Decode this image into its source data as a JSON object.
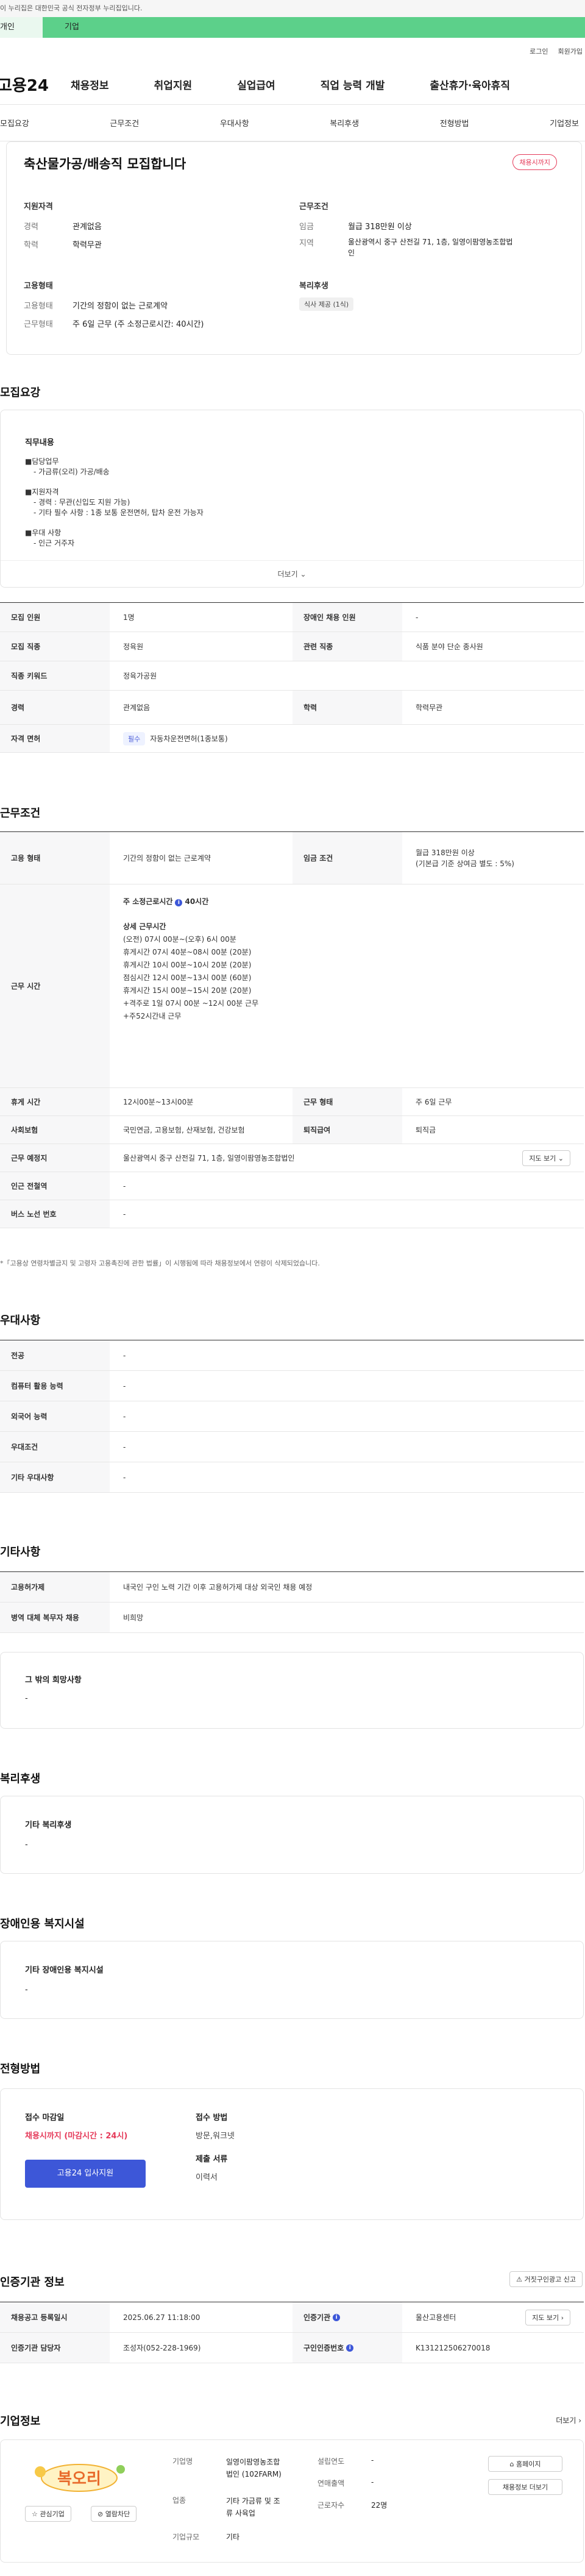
{
  "banner": {
    "text": "이 누리집은 대한민국 공식 전자정부 누리집입니다."
  },
  "tabs": {
    "personal": "개인",
    "company": "기업"
  },
  "util": {
    "login": "로그인",
    "join": "회원가입"
  },
  "gnb": {
    "logo": "고용24",
    "items": [
      "채용정보",
      "취업지원",
      "실업급여",
      "직업 능력 개발",
      "출산휴가·육아휴직"
    ]
  },
  "subnav": [
    "모집요강",
    "근무조건",
    "우대사항",
    "복리후생",
    "전형방법",
    "기업정보"
  ],
  "summary": {
    "title": "축산물가공/배송직 모집합니다",
    "badge": "채용시까지",
    "qual": {
      "heading": "지원자격",
      "career_k": "경력",
      "career_v": "관계없음",
      "edu_k": "학력",
      "edu_v": "학력무관"
    },
    "cond": {
      "heading": "근무조건",
      "wage_k": "임금",
      "wage_v": "월급 318만원 이상",
      "area_k": "지역",
      "area_v1": "울산광역시 중구 산전길 71, 1층, 일영이팜영농조합법",
      "area_v2": "인"
    },
    "emp": {
      "heading": "고용형태",
      "type_k": "고용형태",
      "type_v": "기간의 정함이 없는 근로계약",
      "form_k": "근무형태",
      "form_v": "주 6일 근무 (주 소정근로시간: 40시간)"
    },
    "welfare": {
      "heading": "복리후생",
      "chip": "식사 제공 (1식)"
    }
  },
  "recruit": {
    "heading": "모집요강",
    "box_title": "직무내용",
    "lines": [
      "■담당업무",
      "- 가금류(오리) 가공/배송",
      "■지원자격",
      "- 경력 : 무관(신입도 지원 가능)",
      "- 기타 필수 사항 : 1종 보통 운전면허, 탑차 운전 가능자",
      "■우대 사항",
      "- 인근 거주자"
    ],
    "more": "더보기",
    "table": [
      [
        "모집 인원",
        "1명",
        "장애인 채용 인원",
        "-"
      ],
      [
        "모집 직종",
        "정육원",
        "관련 직종",
        "식품 분야 단순 종사원"
      ],
      [
        "직종 키워드",
        "정육가공원",
        "",
        ""
      ],
      [
        "경력",
        "관계없음",
        "학력",
        "학력무관"
      ],
      [
        "자격 면허",
        "자동차운전면허(1종보통)",
        "",
        ""
      ]
    ],
    "license_chip": "필수"
  },
  "work": {
    "heading": "근무조건",
    "type_k": "고용 형태",
    "type_v": "기간의 정함이 없는 근로계약",
    "wage_k": "임금 조건",
    "wage_v1": "월급 318만원 이상",
    "wage_v2": "(기본급 기준 상여금 별도 : 5%)",
    "time_k": "근무 시간",
    "time_lines": [
      "주 소정근로시간",
      "40시간",
      "상세 근무시간",
      "(오전) 07시 00분~(오후) 6시 00분",
      "휴게시간  07시 40분~08시 00분 (20분)",
      "휴게시간 10시 00분~10시 20분 (20분)",
      "점심시간 12시 00분~13시 00분 (60분)",
      "휴게시간 15시 00분~15시 20분 (20분)",
      "+격주로 1일  07시 00분 ~12시 00분  근무",
      "+주52시간내 근무"
    ],
    "rest_k": "휴게 시간",
    "rest_v": "12시00분~13시00분",
    "form_k": "근무 형태",
    "form_v": "주 6일 근무",
    "ins_k": "사회보험",
    "ins_v": "국민연금, 고용보험, 산재보험, 건강보험",
    "sev_k": "퇴직급여",
    "sev_v": "퇴직금",
    "place_k": "근무 예정지",
    "place_v": "울산광역시 중구 산전길 71, 1층, 일영이팜영농조합법인",
    "map_btn": "지도 보기",
    "station_k": "인근 전철역",
    "station_v": "-",
    "bus_k": "버스 노선 번호",
    "bus_v": "-",
    "note": "*「고용상 연령차별금지 및 고령자 고용촉진에 관한 법률」이 시행됨에 따라 채용정보에서 연령이 삭제되었습니다."
  },
  "pref": {
    "heading": "우대사항",
    "rows": [
      [
        "전공",
        "-"
      ],
      [
        "컴퓨터 활용 능력",
        "-"
      ],
      [
        "외국어 능력",
        "-"
      ],
      [
        "우대조건",
        "-"
      ],
      [
        "기타 우대사항",
        "-"
      ]
    ]
  },
  "etc": {
    "heading": "기타사항",
    "rows": [
      [
        "고용허가제",
        "내국인 구인 노력 기간 이후 고용허가제 대상 외국인 채용 예정"
      ],
      [
        "병역 대체 복무자 채용",
        "비희망"
      ]
    ],
    "box_title": "그 밖의 희망사항",
    "box_v": "-"
  },
  "welfare": {
    "heading": "복리후생",
    "box_title": "기타 복리후생",
    "box_v": "-"
  },
  "disability": {
    "heading": "장애인용 복지시설",
    "box_title": "기타 장애인용 복지시설",
    "box_v": "-"
  },
  "selection": {
    "heading": "전형방법",
    "deadline_k": "접수 마감일",
    "deadline_v": "채용시까지 (마감시간 : 24시)",
    "apply_btn": "고용24 입사지원",
    "method_k": "접수 방법",
    "method_v": "방문,워크넷",
    "docs_k": "제출 서류",
    "docs_v": "이력서"
  },
  "agency": {
    "heading": "인증기관 정보",
    "report_btn": "거짓구인광고 신고",
    "reg_k": "채용공고 등록일시",
    "reg_v": "2025.06.27 11:18:00",
    "org_k": "인증기관",
    "org_v": "울산고용센터",
    "map_btn": "지도 보기",
    "mgr_k": "인증기관 담당자",
    "mgr_v": "조성자(052-228-1969)",
    "num_k": "구인인증번호",
    "num_v": "K131212506270018"
  },
  "company": {
    "heading": "기업정보",
    "more": "더보기",
    "logo_text": "복오리",
    "fav_btn": "관심기업",
    "block_btn": "열람차단",
    "name_k": "기업명",
    "name_v1": "일영이팜영농조합",
    "name_v2": "법인 (102FARM)",
    "ind_k": "업종",
    "ind_v1": "기타 가금류 및 조",
    "ind_v2": "류 사육업",
    "size_k": "기업규모",
    "size_v": "기타",
    "year_k": "설립연도",
    "year_v": "-",
    "sales_k": "연매출액",
    "sales_v": "-",
    "emp_k": "근로자수",
    "emp_v": "22명",
    "home_btn": "홈페이지",
    "jobs_btn": "채용정보 더보기"
  }
}
